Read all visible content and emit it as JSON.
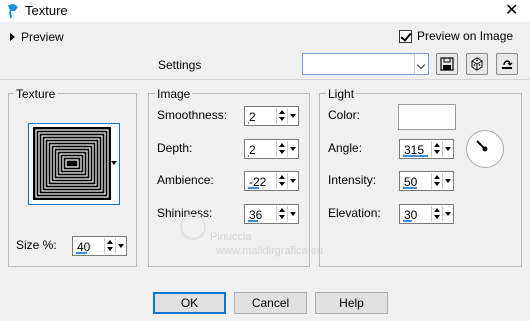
{
  "window": {
    "title": "Texture",
    "close_glyph": "✕"
  },
  "top": {
    "preview_label": "Preview",
    "preview_on_image_label": "Preview on Image",
    "preview_on_image_checked": true,
    "settings_label": "Settings",
    "settings_value": ""
  },
  "texture_group": {
    "title": "Texture",
    "size_label": "Size %:",
    "size_value": "40",
    "size_fraction": 0.4
  },
  "image_group": {
    "title": "Image",
    "fields": [
      {
        "label": "Smoothness:",
        "value": "2",
        "fraction": 0.02
      },
      {
        "label": "Depth:",
        "value": "2",
        "fraction": 0.02
      },
      {
        "label": "Ambience:",
        "value": "-22",
        "fraction": 0.39
      },
      {
        "label": "Shininess:",
        "value": "36",
        "fraction": 0.36
      }
    ]
  },
  "light_group": {
    "title": "Light",
    "color_label": "Color:",
    "color_value": "#ffffff",
    "angle_label": "Angle:",
    "angle_value": "315",
    "angle_fraction": 0.875,
    "intensity_label": "Intensity:",
    "intensity_value": "50",
    "intensity_fraction": 0.5,
    "elevation_label": "Elevation:",
    "elevation_value": "30",
    "elevation_fraction": 0.33
  },
  "buttons": {
    "ok": "OK",
    "cancel": "Cancel",
    "help": "Help"
  },
  "watermark": {
    "line1": "Pinuccia",
    "line2": "www.maildirgrafica.eu"
  },
  "colors": {
    "accent": "#0078d7",
    "slider": "#3a8fd9",
    "background": "#f0f0f0"
  },
  "icons": [
    "app-icon",
    "save-icon",
    "dice-icon",
    "reset-icon",
    "chevron-down-icon",
    "light-dial-icon"
  ]
}
